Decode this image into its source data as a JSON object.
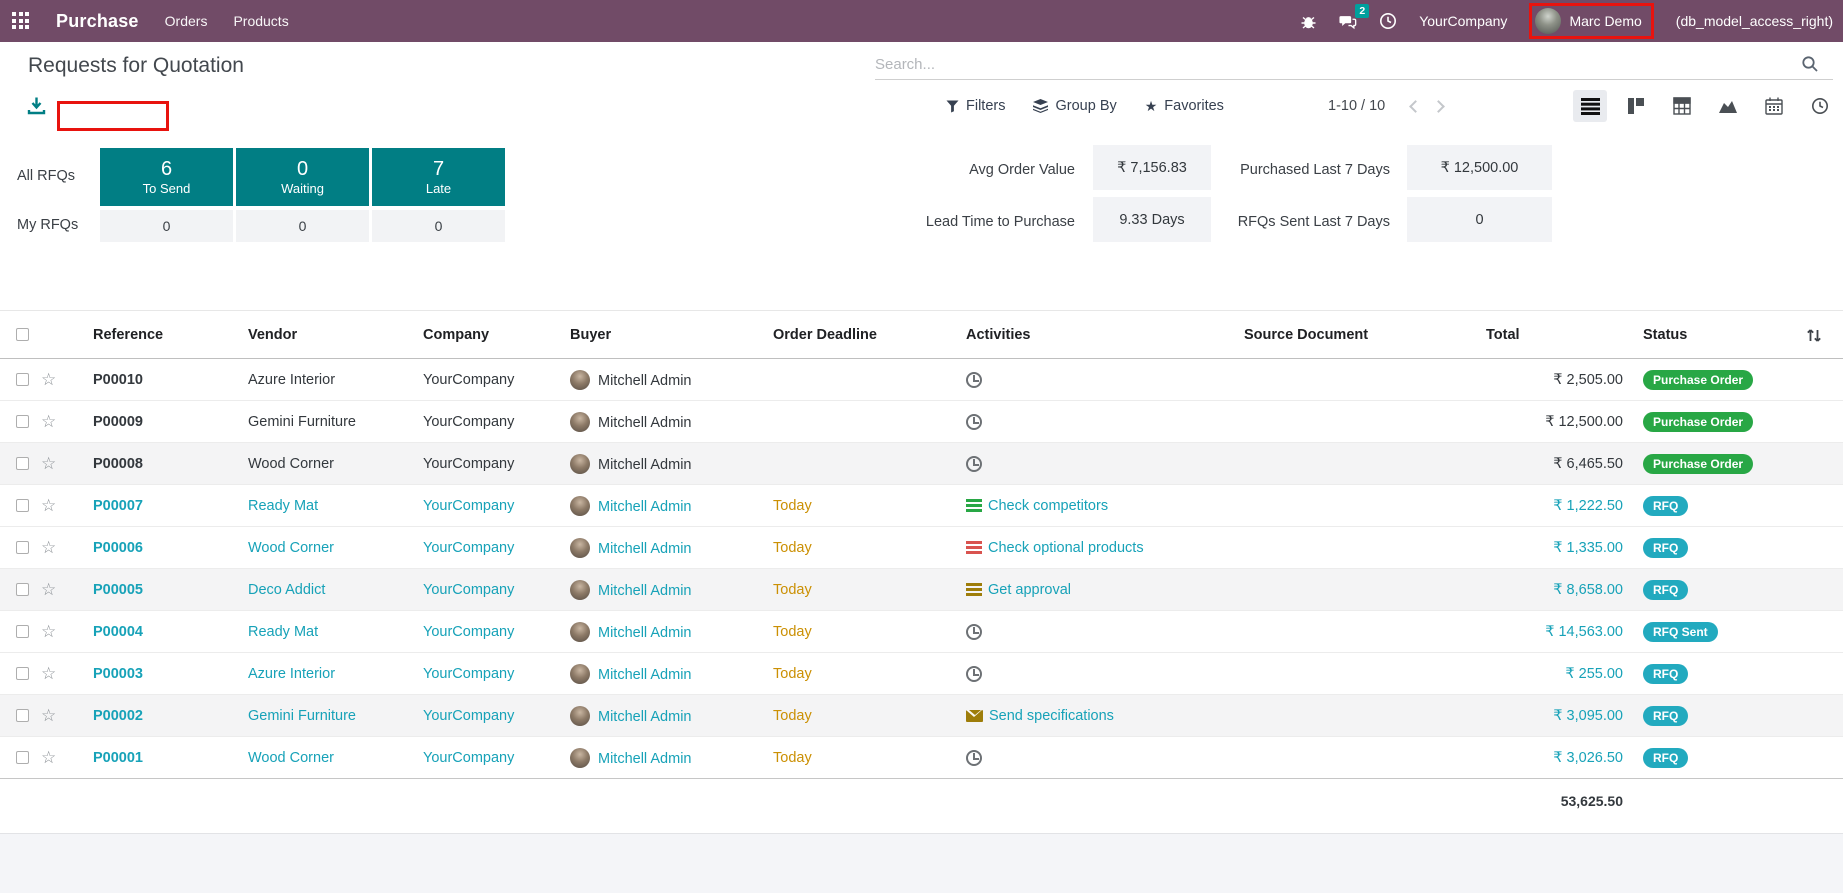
{
  "navbar": {
    "app_name": "Purchase",
    "menus": [
      {
        "label": "Orders"
      },
      {
        "label": "Products"
      }
    ],
    "systray": {
      "icons": [
        "bug-icon",
        "messages-icon",
        "activity-clock-icon"
      ],
      "message_count": "2",
      "company": "YourCompany",
      "user": "Marc Demo",
      "user_suffix": "(db_model_access_right)"
    }
  },
  "control_panel": {
    "title": "Requests for Quotation",
    "search_placeholder": "Search...",
    "filters_label": "Filters",
    "group_by_label": "Group By",
    "favorites_label": "Favorites",
    "pager": "1-10 / 10",
    "view_switcher": [
      "list",
      "kanban",
      "pivot",
      "graph",
      "calendar",
      "activity"
    ]
  },
  "dashboard": {
    "row_labels": {
      "all": "All RFQs",
      "my": "My RFQs"
    },
    "cards": [
      {
        "value": "6",
        "label": "To Send",
        "my_value": "0"
      },
      {
        "value": "0",
        "label": "Waiting",
        "my_value": "0"
      },
      {
        "value": "7",
        "label": "Late",
        "my_value": "0"
      }
    ],
    "stats": [
      {
        "label": "Avg Order Value",
        "value": "₹ 7,156.83"
      },
      {
        "label": "Purchased Last 7 Days",
        "value": "₹ 12,500.00"
      },
      {
        "label": "Lead Time to Purchase",
        "value": "9.33 Days"
      },
      {
        "label": "RFQs Sent Last 7 Days",
        "value": "0"
      }
    ]
  },
  "table": {
    "headers": [
      "Reference",
      "Vendor",
      "Company",
      "Buyer",
      "Order Deadline",
      "Activities",
      "Source Document",
      "Total",
      "Status"
    ],
    "rows": [
      {
        "reference": "P00010",
        "vendor": "Azure Interior",
        "company": "YourCompany",
        "buyer": "Mitchell Admin",
        "deadline": "",
        "activity": {
          "icon": "clock-icon",
          "color": "#6d7175",
          "label": ""
        },
        "source": "",
        "total": "₹ 2,505.00",
        "status": "Purchase Order",
        "status_type": "success",
        "style": "normal",
        "striped": false
      },
      {
        "reference": "P00009",
        "vendor": "Gemini Furniture",
        "company": "YourCompany",
        "buyer": "Mitchell Admin",
        "deadline": "",
        "activity": {
          "icon": "clock-icon",
          "color": "#6d7175",
          "label": ""
        },
        "source": "",
        "total": "₹ 12,500.00",
        "status": "Purchase Order",
        "status_type": "success",
        "style": "normal",
        "striped": false
      },
      {
        "reference": "P00008",
        "vendor": "Wood Corner",
        "company": "YourCompany",
        "buyer": "Mitchell Admin",
        "deadline": "",
        "activity": {
          "icon": "clock-icon",
          "color": "#6d7175",
          "label": ""
        },
        "source": "",
        "total": "₹ 6,465.50",
        "status": "Purchase Order",
        "status_type": "success",
        "style": "normal",
        "striped": true
      },
      {
        "reference": "P00007",
        "vendor": "Ready Mat",
        "company": "YourCompany",
        "buyer": "Mitchell Admin",
        "deadline": "Today",
        "activity": {
          "icon": "tasks-icon",
          "color": "#28a745",
          "label": "Check competitors"
        },
        "source": "",
        "total": "₹ 1,222.50",
        "status": "RFQ",
        "status_type": "info",
        "style": "info",
        "striped": false
      },
      {
        "reference": "P00006",
        "vendor": "Wood Corner",
        "company": "YourCompany",
        "buyer": "Mitchell Admin",
        "deadline": "Today",
        "activity": {
          "icon": "tasks-icon",
          "color": "#d9534f",
          "label": "Check optional products"
        },
        "source": "",
        "total": "₹ 1,335.00",
        "status": "RFQ",
        "status_type": "info",
        "style": "info",
        "striped": false
      },
      {
        "reference": "P00005",
        "vendor": "Deco Addict",
        "company": "YourCompany",
        "buyer": "Mitchell Admin",
        "deadline": "Today",
        "activity": {
          "icon": "tasks-icon",
          "color": "#9e7d0a",
          "label": "Get approval"
        },
        "source": "",
        "total": "₹ 8,658.00",
        "status": "RFQ",
        "status_type": "info",
        "style": "info",
        "striped": true
      },
      {
        "reference": "P00004",
        "vendor": "Ready Mat",
        "company": "YourCompany",
        "buyer": "Mitchell Admin",
        "deadline": "Today",
        "activity": {
          "icon": "clock-icon",
          "color": "#6d7175",
          "label": ""
        },
        "source": "",
        "total": "₹ 14,563.00",
        "status": "RFQ Sent",
        "status_type": "info",
        "style": "info",
        "striped": false
      },
      {
        "reference": "P00003",
        "vendor": "Azure Interior",
        "company": "YourCompany",
        "buyer": "Mitchell Admin",
        "deadline": "Today",
        "activity": {
          "icon": "clock-icon",
          "color": "#6d7175",
          "label": ""
        },
        "source": "",
        "total": "₹ 255.00",
        "status": "RFQ",
        "status_type": "info",
        "style": "info",
        "striped": false
      },
      {
        "reference": "P00002",
        "vendor": "Gemini Furniture",
        "company": "YourCompany",
        "buyer": "Mitchell Admin",
        "deadline": "Today",
        "activity": {
          "icon": "envelope-icon",
          "color": "#9e7d0a",
          "label": "Send specifications"
        },
        "source": "",
        "total": "₹ 3,095.00",
        "status": "RFQ",
        "status_type": "info",
        "style": "info",
        "striped": true
      },
      {
        "reference": "P00001",
        "vendor": "Wood Corner",
        "company": "YourCompany",
        "buyer": "Mitchell Admin",
        "deadline": "Today",
        "activity": {
          "icon": "clock-icon",
          "color": "#6d7175",
          "label": ""
        },
        "source": "",
        "total": "₹ 3,026.50",
        "status": "RFQ",
        "status_type": "info",
        "style": "info",
        "striped": false
      }
    ],
    "footer_total": "53,625.50"
  },
  "colors": {
    "navbar_bg": "#714b67",
    "kpi_teal": "#017e84",
    "status_success": "#28a745",
    "status_info": "#22aabf",
    "row_info_text": "#17a2b8",
    "deadline_warning": "#cb9004",
    "annotation_red": "#e8130e",
    "message_badge": "#00a09d"
  }
}
